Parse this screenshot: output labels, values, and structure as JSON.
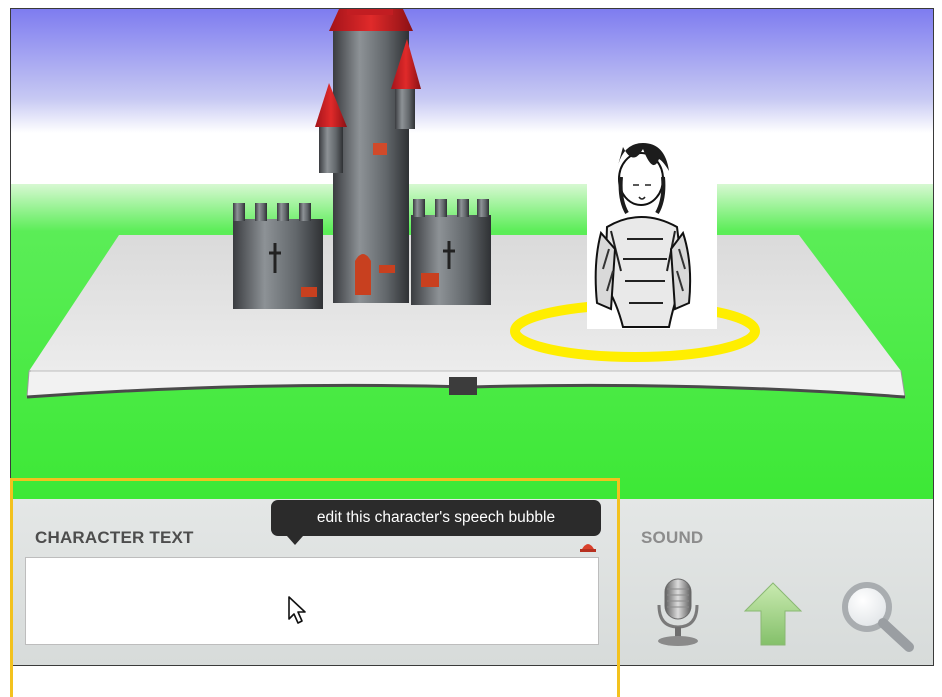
{
  "panel": {
    "character_text_label": "CHARACTER TEXT",
    "sound_label": "SOUND",
    "speech_input_value": "",
    "speech_input_placeholder": ""
  },
  "tooltip": {
    "text": "edit this character's speech bubble"
  },
  "icons": {
    "record": "microphone-icon",
    "upload": "upload-arrow-icon",
    "search": "magnifier-icon",
    "small": "small-red-icon"
  },
  "colors": {
    "sky_top": "#7e7cf0",
    "ground": "#40e83c",
    "selection_ring": "#ffee00",
    "highlight_border": "#f3c21e",
    "tooltip_bg": "#2b2b2b"
  }
}
